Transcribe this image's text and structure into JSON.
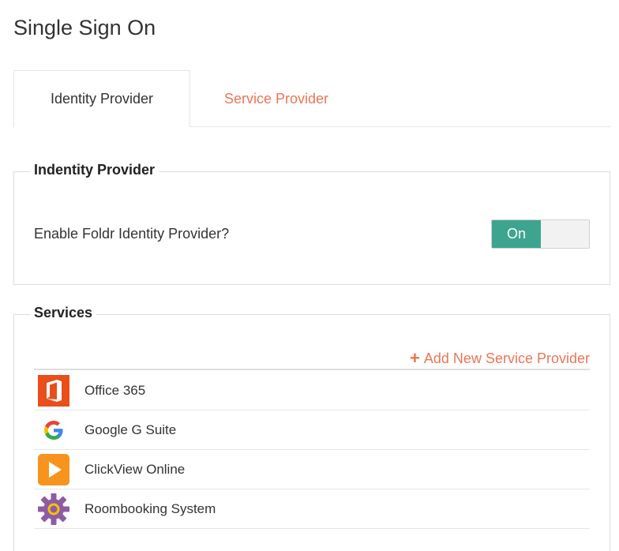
{
  "page": {
    "title": "Single Sign On"
  },
  "tabs": [
    {
      "label": "Identity Provider",
      "active": true
    },
    {
      "label": "Service Provider",
      "active": false
    }
  ],
  "identity_panel": {
    "legend": "Indentity Provider",
    "question": "Enable Foldr Identity Provider?",
    "toggle": {
      "label": "On",
      "state": true
    }
  },
  "services_panel": {
    "legend": "Services",
    "add_label": "Add New Service Provider",
    "items": [
      {
        "label": "Office 365",
        "icon": "office-365-icon"
      },
      {
        "label": "Google G Suite",
        "icon": "google-icon"
      },
      {
        "label": "ClickView Online",
        "icon": "clickview-icon"
      },
      {
        "label": "Roombooking System",
        "icon": "gear-icon"
      }
    ]
  },
  "colors": {
    "accent": "#ec7556",
    "toggle_on": "#3da58f",
    "border": "#dcdcdc"
  }
}
